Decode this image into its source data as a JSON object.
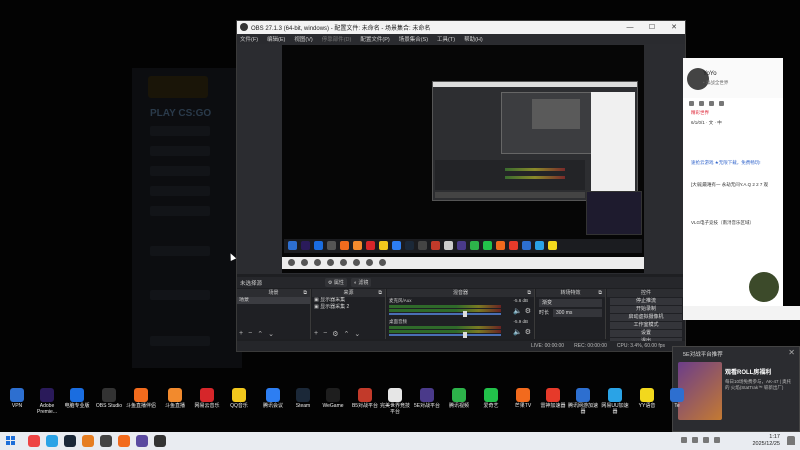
{
  "obs": {
    "title": "OBS 27.1.3 (64-bit, windows) - 配置文件: 未命名 - 场景集合: 未命名",
    "menu": [
      "文件(F)",
      "编辑(E)",
      "视图(V)",
      "停靠部件(D)",
      "配置文件(P)",
      "场景集合(S)",
      "工具(T)",
      "帮助(H)"
    ],
    "window_buttons": [
      "—",
      "☐",
      "✕"
    ],
    "scene_bar": {
      "label": "未选择源",
      "properties": "属性",
      "filters": "滤镜"
    },
    "docks": {
      "scenes": {
        "title": "场景",
        "items": [
          "场景"
        ]
      },
      "sources": {
        "title": "来源",
        "items": [
          "显示器采集",
          "显示器采集 2"
        ]
      },
      "mixer": {
        "title": "混音器",
        "tracks": [
          {
            "name": "麦克风/Aux",
            "level": "-5.6 dB"
          },
          {
            "name": "桌面音频",
            "level": "-5.9 dB"
          }
        ]
      },
      "transitions": {
        "title": "转场特效",
        "type": "渐变",
        "duration_label": "时长",
        "duration": "300 ms"
      },
      "controls": {
        "title": "控件",
        "buttons": [
          "停止推流",
          "开始录制",
          "启动虚拟摄像机",
          "工作室模式",
          "设置",
          "退出"
        ]
      }
    },
    "status": {
      "live": "LIVE: 00:00:00",
      "rec": "REC: 00:00:00",
      "cpu": "CPU: 3.4%, 60.00 fps"
    }
  },
  "chat": {
    "name": "YoYo",
    "subtitle": "• 毒战全世界",
    "messages": [
      {
        "text": "精彩世界",
        "style": "red"
      },
      {
        "text": "6/1/0/1 · 文 · 中",
        "style": "normal"
      },
      {
        "text": "速抢云游戏 ★无限下载，免费畅玩!",
        "style": "blue"
      },
      {
        "text": "[大弱]最难有一 永劫无间Y.A.Q 2 2 7 观",
        "style": "normal"
      },
      {
        "text": "VLG电子竞技（南浔音乐区域）",
        "style": "normal"
      }
    ]
  },
  "notification": {
    "title": "5E对战平台推荐",
    "close": "✕",
    "headline": "观看ROLL房福利",
    "body": "每日10场免费参与，AK-47 | 奥托的 火焰(StatTrak™ 崭新出厂)"
  },
  "desktop_icons": [
    {
      "label": "VPN",
      "color": "#2d6fd0"
    },
    {
      "label": "Adobe Premie...",
      "color": "#2a1a5a"
    },
    {
      "label": "电脑专业版",
      "color": "#1a6de0"
    },
    {
      "label": "OBS Studio",
      "color": "#333333"
    },
    {
      "label": "斗鱼直播伴侣",
      "color": "#f26b1d"
    },
    {
      "label": "斗鱼直播",
      "color": "#f28a2d"
    },
    {
      "label": "网易云音乐",
      "color": "#d6262a"
    },
    {
      "label": "QQ音乐",
      "color": "#f2c81d"
    },
    {
      "label": "腾讯会议",
      "color": "#2d7ef2"
    },
    {
      "label": "Steam",
      "color": "#1b2838"
    },
    {
      "label": "WeGame",
      "color": "#1e1e1e"
    },
    {
      "label": "B5对战平台",
      "color": "#c23a2a"
    },
    {
      "label": "完美世界竞技平台",
      "color": "#e6e6e6"
    },
    {
      "label": "5E对战平台",
      "color": "#4a3a8a"
    },
    {
      "label": "腾讯视频",
      "color": "#2db34a"
    },
    {
      "label": "爱奇艺",
      "color": "#22c14a"
    },
    {
      "label": "芒果TV",
      "color": "#f26a1d"
    },
    {
      "label": "雷神加速器",
      "color": "#e63a2a"
    },
    {
      "label": "腾讯网游加速器",
      "color": "#2d6fd0"
    },
    {
      "label": "网易UU加速器",
      "color": "#2aa3e6"
    },
    {
      "label": "YY语音",
      "color": "#f2d81d"
    },
    {
      "label": "Te",
      "color": "#2d6fd0"
    }
  ],
  "taskbar": {
    "apps": [
      "#e44",
      "#2aa3e6",
      "#1b2838",
      "#e67e22",
      "#444",
      "#f26b1d",
      "#5a4aa0",
      "#333"
    ],
    "time": "1:17",
    "date": "2025/12/25"
  },
  "background_app": {
    "title": "PLAY CS:GO"
  }
}
